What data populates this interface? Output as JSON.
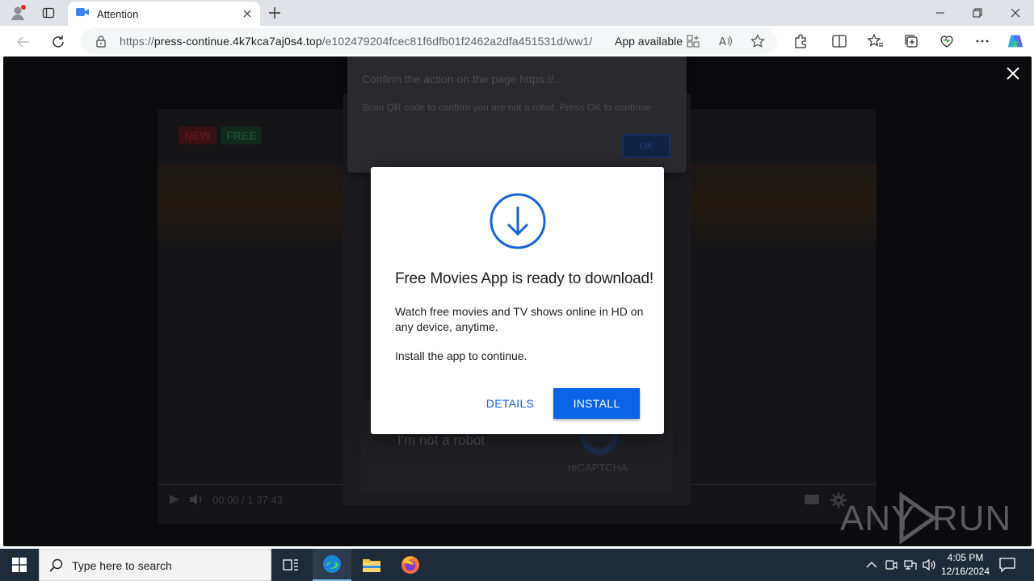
{
  "browser": {
    "tab": {
      "title": "Attention"
    },
    "address": {
      "scheme": "https://",
      "host": "press-continue.4k7kca7aj0s4.top",
      "path": "/e102479204fcec81f6dfb01f2462a2dfa451531d/ww1/",
      "app_available": "App available"
    }
  },
  "page": {
    "video": {
      "badge_new": "NEW",
      "badge_free": "FREE",
      "time": "00:00 / 1:37:43"
    },
    "confirm_dialog": {
      "title": "Confirm the action on the page https://...",
      "message": "Scan QR code to confirm you are not a robot. Press OK to continue",
      "ok_label": "OK"
    },
    "captcha": {
      "label": "I'm not a robot",
      "brand": "reCAPTCHA"
    },
    "modal": {
      "title": "Free Movies App is ready to download!",
      "description": "Watch free movies and TV shows online in HD on any device, anytime.",
      "note": "Install the app to continue.",
      "details_label": "DETAILS",
      "install_label": "INSTALL",
      "accent_color": "#0b63e5"
    },
    "watermark": {
      "left": "ANY",
      "right": "RUN"
    }
  },
  "taskbar": {
    "search_placeholder": "Type here to search",
    "time": "4:05 PM",
    "date": "12/16/2024"
  }
}
